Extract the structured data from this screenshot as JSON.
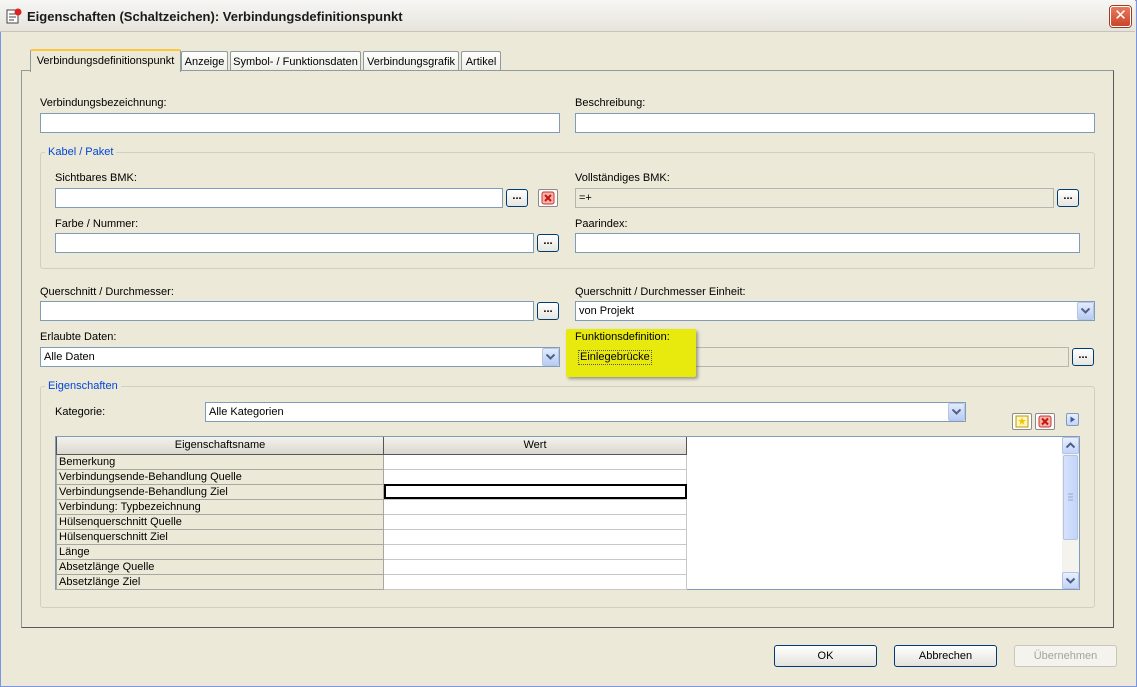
{
  "window": {
    "title": "Eigenschaften (Schaltzeichen): Verbindungsdefinitionspunkt",
    "close_glyph": "✕"
  },
  "tabs": [
    {
      "label": "Verbindungsdefinitionspunkt",
      "active": true
    },
    {
      "label": "Anzeige"
    },
    {
      "label": "Symbol- / Funktionsdaten"
    },
    {
      "label": "Verbindungsgrafik"
    },
    {
      "label": "Artikel"
    }
  ],
  "form": {
    "verbindungsbezeichnung": {
      "label": "Verbindungsbezeichnung:",
      "value": ""
    },
    "beschreibung": {
      "label": "Beschreibung:",
      "value": ""
    },
    "kabel_group": {
      "title": "Kabel / Paket",
      "sichtbares_bmk": {
        "label": "Sichtbares BMK:",
        "value": ""
      },
      "vollstaendiges_bmk": {
        "label": "Vollständiges BMK:",
        "value": "=+"
      },
      "farbe_nummer": {
        "label": "Farbe / Nummer:",
        "value": ""
      },
      "paarindex": {
        "label": "Paarindex:",
        "value": ""
      }
    },
    "querschnitt": {
      "label": "Querschnitt / Durchmesser:",
      "value": ""
    },
    "querschnitt_einheit": {
      "label": "Querschnitt / Durchmesser Einheit:",
      "value": "von Projekt"
    },
    "erlaubte_daten": {
      "label": "Erlaubte Daten:",
      "value": "Alle Daten"
    },
    "funktionsdefinition": {
      "label": "Funktionsdefinition:",
      "value": "Einlegebrücke"
    },
    "dots_label": "..."
  },
  "eigenschaften": {
    "title": "Eigenschaften",
    "kategorie_label": "Kategorie:",
    "kategorie_value": "Alle Kategorien",
    "columns": [
      "Eigenschaftsname",
      "Wert"
    ],
    "rows": [
      "Bemerkung",
      "Verbindungsende-Behandlung Quelle",
      "Verbindungsende-Behandlung Ziel",
      "Verbindung: Typbezeichnung",
      "Hülsenquerschnitt Quelle",
      "Hülsenquerschnitt Ziel",
      "Länge",
      "Absetzlänge Quelle",
      "Absetzlänge Ziel"
    ],
    "focused_row": 2
  },
  "buttons": {
    "ok": "OK",
    "cancel": "Abbrechen",
    "apply": "Übernehmen"
  },
  "colors": {
    "highlight": "#e8ea0e",
    "group_title": "#0046d5",
    "close": "#c9452a"
  }
}
